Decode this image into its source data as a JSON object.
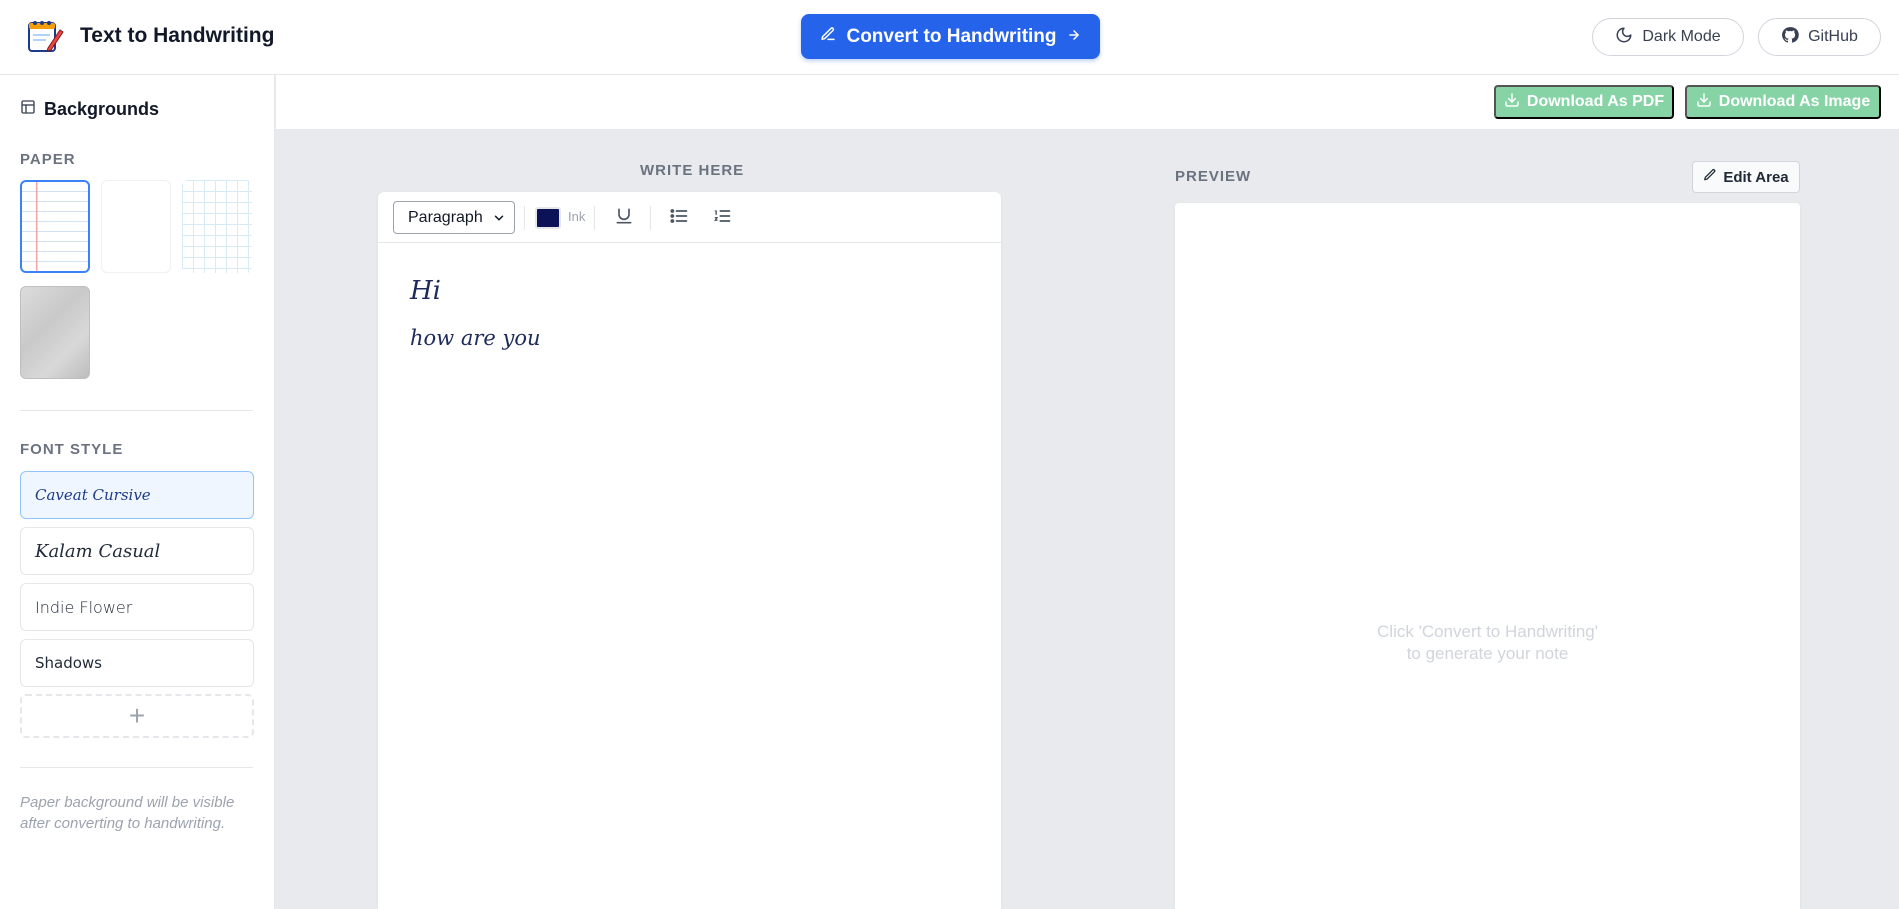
{
  "header": {
    "app_title": "Text to Handwriting",
    "convert_label": "Convert to Handwriting",
    "dark_mode_label": "Dark Mode",
    "github_label": "GitHub"
  },
  "sidebar": {
    "title": "Backgrounds",
    "paper_label": "PAPER",
    "papers": [
      "lined",
      "blank",
      "grid",
      "texture"
    ],
    "selected_paper": "lined",
    "font_style_label": "FONT STYLE",
    "fonts": [
      {
        "label": "Caveat Cursive",
        "active": true
      },
      {
        "label": "Kalam Casual",
        "active": false
      },
      {
        "label": "Indie Flower",
        "active": false
      },
      {
        "label": "Shadows",
        "active": false
      }
    ],
    "add_label": "+",
    "note": "Paper background will be visible after converting to handwriting."
  },
  "actions": {
    "download_pdf": "Download As PDF",
    "download_image": "Download As Image"
  },
  "editor": {
    "label": "WRITE HERE",
    "block_type": "Paragraph",
    "ink_label": "Ink",
    "ink_color": "#0b1257",
    "lines": [
      "Hi",
      "how are you"
    ]
  },
  "preview": {
    "label": "PREVIEW",
    "edit_area_label": "Edit Area",
    "empty_line1": "Click 'Convert to Handwriting'",
    "empty_line2": "to generate your note"
  },
  "colors": {
    "primary": "#2563eb",
    "download": "#86d3a5",
    "active_border": "#3b82f6"
  },
  "icons": [
    "notepad-logo-icon",
    "pencil-icon",
    "arrow-right-icon",
    "moon-icon",
    "github-icon",
    "layout-icon",
    "download-icon",
    "chevron-down-icon",
    "underline-icon",
    "bullet-list-icon",
    "numbered-list-icon",
    "plus-icon"
  ]
}
